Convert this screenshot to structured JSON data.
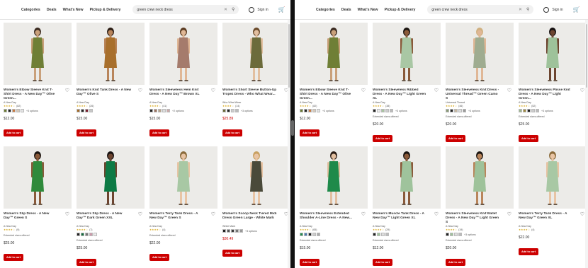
{
  "nav": {
    "categories": "Categories",
    "deals": "Deals",
    "whats_new": "What's New",
    "pickup": "Pickup & Delivery",
    "sign_in": "Sign in"
  },
  "left": {
    "search_value": "green crew neck dress",
    "products": [
      {
        "title": "Women's Elbow Sleeve Knit T-Shirt Dress - A New Day™ Olive Green...",
        "brand": "A New Day",
        "stars": "★★★★☆",
        "count": "(82)",
        "options": "+3 options",
        "note": "",
        "price": "$12.00",
        "sale": false,
        "swatches": [
          "#6b7a33",
          "#222",
          "#c97b43",
          "#d7c9b8",
          "#e6e6e6"
        ],
        "dress": "#6f7f36",
        "skin": "#c9a07a",
        "hair": "#3a2a20"
      },
      {
        "title": "Women's Knit Tank Dress - A New Day™ Olive S",
        "brand": "A New Day",
        "stars": "★★★★☆",
        "count": "(26)",
        "options": "",
        "note": "",
        "price": "$15.00",
        "sale": false,
        "swatches": [
          "#a26a2a",
          "#222",
          "#7a1f2e",
          "#c7c7c7"
        ],
        "dress": "#a86f2c",
        "skin": "#b9855b",
        "hair": "#2a1c14"
      },
      {
        "title": "Women's Sleeveless Hem Knit Dress - A New Day™ Brown XL",
        "brand": "A New Day",
        "stars": "★★★★☆",
        "count": "(41)",
        "options": "+2 options",
        "note": "",
        "price": "$15.00",
        "sale": false,
        "swatches": [
          "#222",
          "#9c7360",
          "#b9a48a",
          "#ddd",
          "#caa"
        ],
        "dress": "#a57b6c",
        "skin": "#e0b796",
        "hair": "#5a3a20"
      },
      {
        "title": "Women's Short Sleeve Button-Up Tropez Dress - Who What Wear...",
        "brand": "Who What Wear",
        "stars": "★★★★☆",
        "count": "(14)",
        "options": "+3 options",
        "note": "",
        "price": "$25.89",
        "sale": true,
        "swatches": [
          "#6b6b3a",
          "#222",
          "#ccc",
          "#bbb"
        ],
        "dress": "#6c6b3b",
        "skin": "#e2bfa0",
        "hair": "#6a4a2a"
      },
      {
        "title": "Women's Slip Dress - A New Day™ Green S",
        "brand": "A New Day",
        "stars": "★★★★☆",
        "count": "(9)",
        "options": "",
        "note": "Extended sizes offered",
        "price": "$25.00",
        "sale": false,
        "swatches": [],
        "dress": "#2f8a3b",
        "skin": "#8a5a3a",
        "hair": "#1a1410"
      },
      {
        "title": "Women's Slip Dress - A New Day™ Dark Green XXL",
        "brand": "A New Day",
        "stars": "★★★★☆",
        "count": "(7)",
        "options": "",
        "note": "Extended sizes offered",
        "price": "$25.00",
        "sale": false,
        "swatches": [
          "#222",
          "#0f6b3a",
          "#777",
          "#c9a",
          "#eee"
        ],
        "dress": "#0d7a45",
        "skin": "#6d4530",
        "hair": "#151010"
      },
      {
        "title": "Women's Terry Tank Dress - A New Day™ Green S",
        "brand": "A New Day",
        "stars": "★★★★☆",
        "count": "(4)",
        "options": "",
        "note": "Extended sizes offered",
        "price": "$22.00",
        "sale": false,
        "swatches": [],
        "dress": "#a8c8a4",
        "skin": "#e8c4a4",
        "hair": "#8a6a3a"
      },
      {
        "title": "Women's Scoop Neck Tiered Midi Dress Green Large - White Mark",
        "brand": "White Mark",
        "stars": "",
        "count": "",
        "options": "+3 options",
        "note": "",
        "price": "$30.49",
        "sale": true,
        "swatches": [
          "#222",
          "#555",
          "#3a3a3a",
          "#777",
          "#999"
        ],
        "dress": "#4a4a3a",
        "skin": "#e8c4a4",
        "hair": "#c8a060"
      }
    ]
  },
  "right": {
    "search_value": "green crew neck dress",
    "products": [
      {
        "title": "Women's Elbow Sleeve Knit T-Shirt Dress - A New Day™ Olive Green...",
        "brand": "A New Day",
        "stars": "★★★★☆",
        "count": "(82)",
        "options": "+3 options",
        "note": "",
        "price": "$12.00",
        "sale": false,
        "swatches": [
          "#6b7a33",
          "#222",
          "#c97b43",
          "#d7c9b8",
          "#e6e6e6"
        ],
        "dress": "#6f7f36",
        "skin": "#c9a07a",
        "hair": "#3a2a20"
      },
      {
        "title": "Women's Sleeveless Ribbed Dress - A New Day™ Light Green XL",
        "brand": "A New Day",
        "stars": "★★★★☆",
        "count": "(38)",
        "options": "+3 options",
        "note": "Extended sizes offered",
        "price": "$20.00",
        "sale": false,
        "swatches": [
          "#222",
          "#eee",
          "#a8c4a0",
          "#ccc",
          "#bbb"
        ],
        "dress": "#a9c7a4",
        "skin": "#8a5a3a",
        "hair": "#1a1410"
      },
      {
        "title": "Women's Sleeveless Knit Dress - Universal Thread™ Green Camo S",
        "brand": "Universal Thread",
        "stars": "★★★★☆",
        "count": "(46)",
        "options": "+3 options",
        "note": "Extended sizes offered",
        "price": "$20.00",
        "sale": false,
        "swatches": [
          "#8a9a78",
          "#222",
          "#c7b8a0",
          "#ddd",
          "#999"
        ],
        "dress": "#9fac90",
        "skin": "#e0b796",
        "hair": "#d0b080"
      },
      {
        "title": "Women's Sleeveless Plisse Knit Dress - A New Day™ Light Green...",
        "brand": "A New Day",
        "stars": "★★★★☆",
        "count": "(52)",
        "options": "+3 options",
        "note": "Extended sizes offered",
        "price": "$25.00",
        "sale": false,
        "swatches": [
          "#9bb58f",
          "#a08a40",
          "#222",
          "#ccc",
          "#bbb"
        ],
        "dress": "#9ec29a",
        "skin": "#6d4530",
        "hair": "#151010"
      },
      {
        "title": "Women's Sleeveless Extended Shoulder A-Line Dress - A New...",
        "brand": "A New Day",
        "stars": "★★★★☆",
        "count": "(65)",
        "options": "",
        "note": "Extended sizes offered",
        "price": "$15.00",
        "sale": false,
        "swatches": [
          "#1f8a4a",
          "#4a7ab0",
          "#222",
          "#ccc",
          "#aaa"
        ],
        "dress": "#1f8a4a",
        "skin": "#e2bfa0",
        "hair": "#2a1c14"
      },
      {
        "title": "Women's Muscle Tank Dress - A New Day™ Light Green XL",
        "brand": "A New Day",
        "stars": "★★★★☆",
        "count": "(29)",
        "options": "",
        "note": "Extended sizes offered",
        "price": "$12.00",
        "sale": false,
        "swatches": [
          "#222",
          "#9ec29a",
          "#ddd",
          "#bbb"
        ],
        "dress": "#9fc39c",
        "skin": "#8a5a3a",
        "hair": "#1a1410"
      },
      {
        "title": "Women's Sleeveless Knit Ballet Dress - A New Day™ Light Green S",
        "brand": "A New Day",
        "stars": "★★★★☆",
        "count": "(19)",
        "options": "+3 options",
        "note": "Extended sizes offered",
        "price": "$20.00",
        "sale": false,
        "swatches": [
          "#222",
          "#9ec29a",
          "#ddd",
          "#bbb"
        ],
        "dress": "#9ec29a",
        "skin": "#b9855b",
        "hair": "#1a1410"
      },
      {
        "title": "Women's Terry Tank Dress - A New Day™ Green XL",
        "brand": "A New Day",
        "stars": "★★★★☆",
        "count": "(4)",
        "options": "",
        "note": "",
        "price": "$22.00",
        "sale": false,
        "swatches": [],
        "dress": "#a8c8a4",
        "skin": "#e8c4a4",
        "hair": "#8a6a3a"
      }
    ]
  },
  "add_to_cart": "Add to cart",
  "colors": {
    "accent": "#cc0000",
    "sale_price": "#cc0000",
    "star": "#d49e00"
  }
}
